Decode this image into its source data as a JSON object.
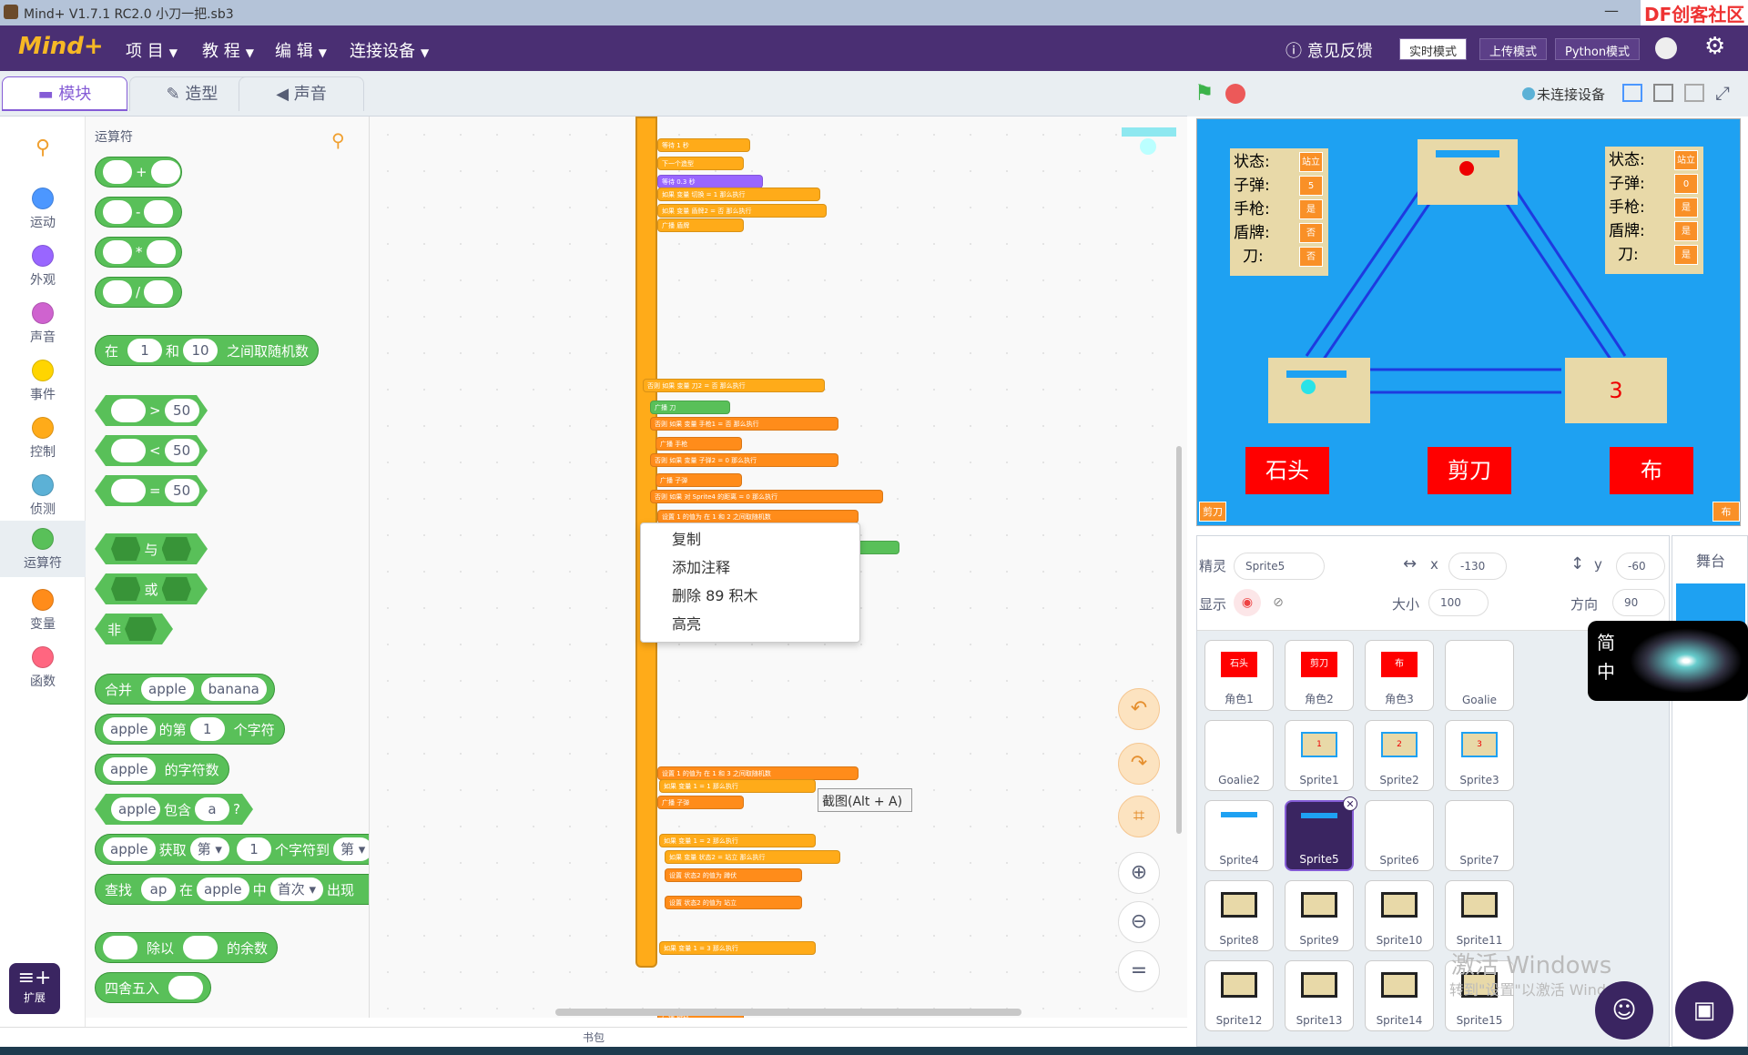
{
  "titlebar": {
    "title": "Mind+ V1.7.1 RC2.0   小刀一把.sb3",
    "minimize": "—",
    "brand": "DF创客社区"
  },
  "menu": {
    "logo": "Mind+",
    "project": "项 目",
    "tutorial": "教 程",
    "edit": "编 辑",
    "connect": "连接设备",
    "feedback": "意见反馈",
    "mode_realtime": "实时模式",
    "mode_upload": "上传模式",
    "mode_python": "Python模式"
  },
  "tabs": {
    "blocks": "模块",
    "costumes": "造型",
    "sounds": "声音"
  },
  "categories": [
    {
      "label": "",
      "color": "#ffffff"
    },
    {
      "label": "运动",
      "color": "#4c97ff"
    },
    {
      "label": "外观",
      "color": "#9966ff"
    },
    {
      "label": "声音",
      "color": "#cf63cf"
    },
    {
      "label": "事件",
      "color": "#ffd500"
    },
    {
      "label": "控制",
      "color": "#ffab19"
    },
    {
      "label": "侦测",
      "color": "#5cb1d6"
    },
    {
      "label": "运算符",
      "color": "#59c059"
    },
    {
      "label": "变量",
      "color": "#ff8c1a"
    },
    {
      "label": "函数",
      "color": "#ff6680"
    }
  ],
  "extension_label": "扩展",
  "palette": {
    "heading": "运算符",
    "plus": "+",
    "minus": "-",
    "times": "*",
    "divide": "/",
    "random": {
      "pre": "在",
      "a": "1",
      "mid": "和",
      "b": "10",
      "post": "之间取随机数"
    },
    "gt": {
      "op": ">",
      "v": "50"
    },
    "lt": {
      "op": "<",
      "v": "50"
    },
    "eq": {
      "op": "=",
      "v": "50"
    },
    "and": "与",
    "or": "或",
    "not": "非",
    "join": {
      "pre": "合并",
      "a": "apple",
      "b": "banana"
    },
    "letter": {
      "a": "apple",
      "mid": "的第",
      "n": "1",
      "post": "个字符"
    },
    "length": {
      "a": "apple",
      "post": "的字符数"
    },
    "contains": {
      "a": "apple",
      "mid": "包含",
      "b": "a",
      "q": "?"
    },
    "substr": {
      "a": "apple",
      "mid": "获取",
      "d1": "第 ▾",
      "n": "1",
      "post": "个字符到",
      "d2": "第 ▾"
    },
    "find": {
      "pre": "查找",
      "a": "ap",
      "mid": "在",
      "b": "apple",
      "mid2": "中",
      "d": "首次 ▾",
      "post": "出现"
    },
    "mod": {
      "mid": "除以",
      "post": "的余数"
    },
    "round": "四舍五入"
  },
  "context_menu": [
    "复制",
    "添加注释",
    "删除 89 积木",
    "高亮"
  ],
  "tooltip": "截图(Alt + A)",
  "backpack": "书包",
  "stage_header": {
    "status": "未连接设备"
  },
  "stage": {
    "left_stats": [
      {
        "k": "状态:",
        "v": "站立"
      },
      {
        "k": "子弹:",
        "v": "5"
      },
      {
        "k": "手枪:",
        "v": "是"
      },
      {
        "k": "盾牌:",
        "v": "否"
      },
      {
        "k": "刀:",
        "v": "否"
      }
    ],
    "right_stats": [
      {
        "k": "状态:",
        "v": "站立"
      },
      {
        "k": "子弹:",
        "v": "0"
      },
      {
        "k": "手枪:",
        "v": "是"
      },
      {
        "k": "盾牌:",
        "v": "是"
      },
      {
        "k": "刀:",
        "v": "是"
      }
    ],
    "box_number": "3",
    "buttons": [
      "石头",
      "剪刀",
      "布"
    ],
    "corner_left": "剪刀",
    "corner_right": "布"
  },
  "sprite_info": {
    "sprite_label": "精灵",
    "sprite_name": "Sprite5",
    "x_label": "x",
    "x": "-130",
    "y_label": "y",
    "y": "-60",
    "show_label": "显示",
    "size_label": "大小",
    "size": "100",
    "direction_label": "方向",
    "direction": "90"
  },
  "stage_panel_label": "舞台",
  "sprites": [
    "角色1",
    "角色2",
    "角色3",
    "Goalie",
    "Goalie2",
    "Sprite1",
    "Sprite2",
    "Sprite3",
    "Sprite4",
    "Sprite5",
    "Sprite6",
    "Sprite7",
    "Sprite8",
    "Sprite9",
    "Sprite10",
    "Sprite11",
    "Sprite12",
    "Sprite13",
    "Sprite14",
    "Sprite15"
  ],
  "sprite_thumbs": {
    "t1": "石头",
    "t2": "剪刀",
    "t3": "布",
    "s1": "1",
    "s2": "2",
    "s3": "3"
  },
  "float_widget": {
    "a": "简",
    "b": "中"
  },
  "watermark": {
    "line1": "激活 Windows",
    "line2": "转到\"设置\"以激活 Windows。"
  },
  "script_blocks": [
    "等待 1 秒",
    "下一个造型",
    "等待 0.3 秒",
    "如果 变量 切换 = 1 那么执行",
    "如果 变量 盾牌2 = 否 那么执行",
    "广播 盾牌",
    "否则 如果 变量 刀2 = 否 那么执行",
    "广播 刀",
    "否则 如果 变量 手枪1 = 否 那么执行",
    "广播 手枪",
    "否则 如果 变量 子弹2 = 0 那么执行",
    "广播 子弹",
    "否则 如果 对 Sprite4 的距离 = 0 那么执行",
    "设置 1 的值为 在 1 和 2 之间取随机数",
    "如果 变量 1 = 1 那么执行",
    "如果 x坐标 = -130 与 y坐标 = -60 那么执行",
    "在 1 秒内滑行到 Sprite1",
    "设置 1 的值为 在 1 和 3 之间取随机数",
    "如果 变量 1 = 1 那么执行",
    "广播 子弹",
    "如果 变量 1 = 2 那么执行",
    "如果 变量 状态2 = 站立 那么执行",
    "设置 状态2 的值为 蹲伏",
    "设置 状态2 的值为 站立",
    "如果 变量 1 = 3 那么执行",
    "广播 跳跃",
    "设置 切换 的值为 0",
    "等待 1 秒",
    "广播 退出"
  ]
}
